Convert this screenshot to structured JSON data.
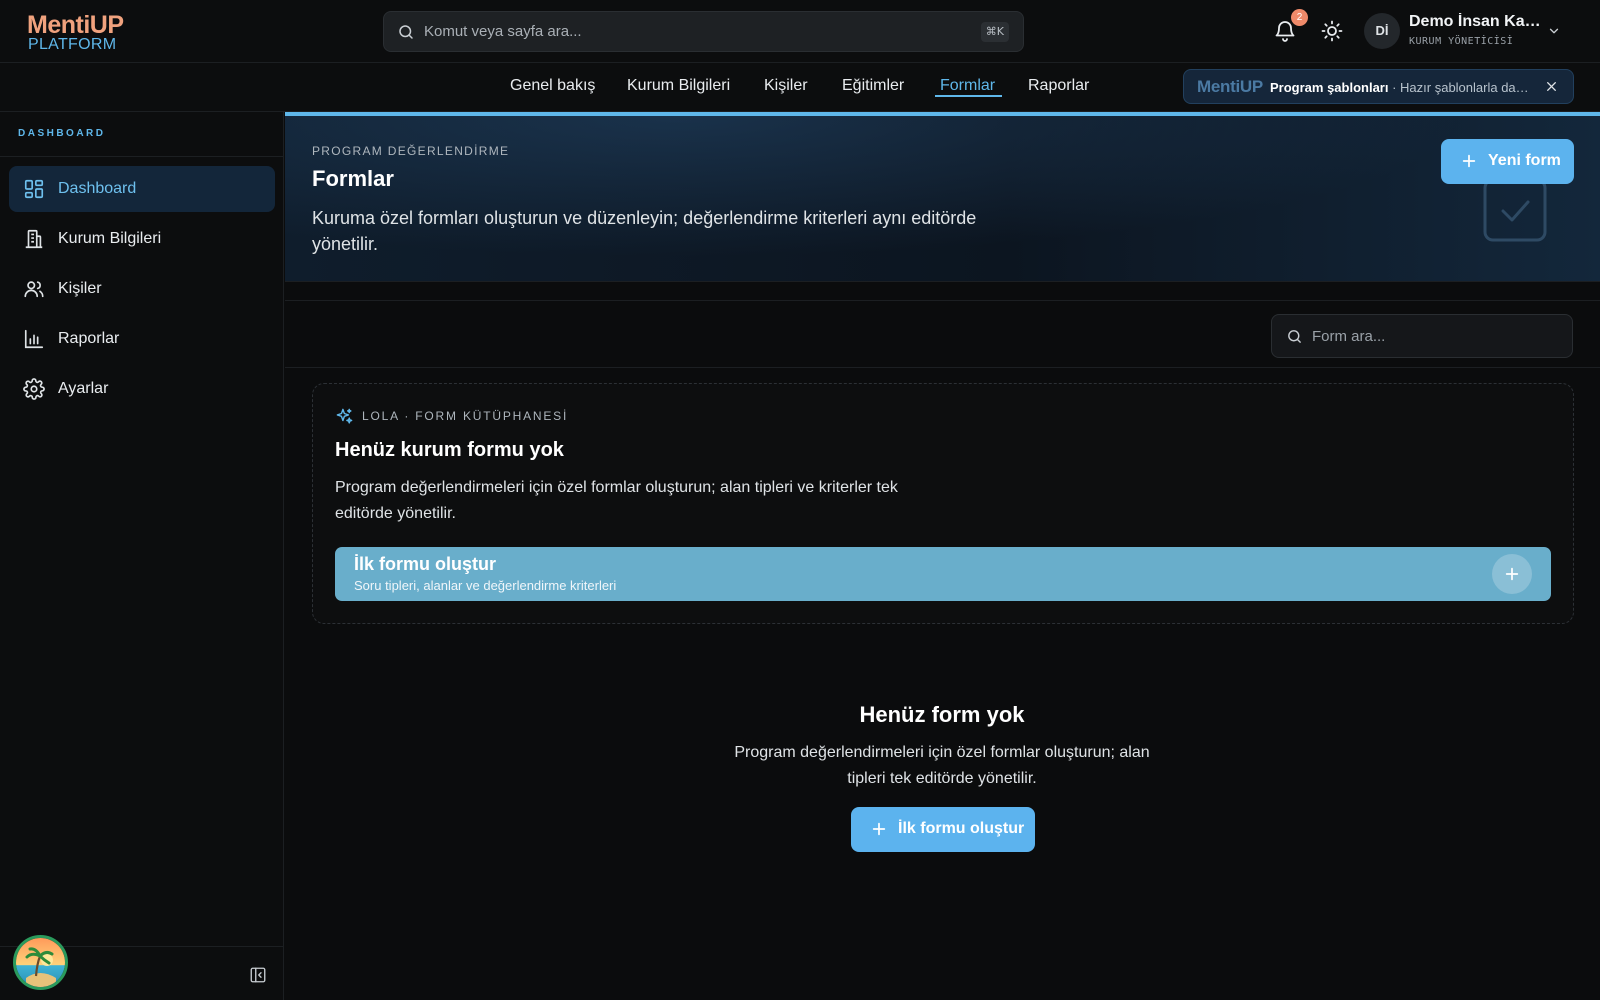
{
  "brand": {
    "line1": "MentiUP",
    "line2": "PLATFORM"
  },
  "command_search": {
    "placeholder": "Komut veya sayfa ara...",
    "shortcut": "⌘K"
  },
  "notifications": {
    "count": "2"
  },
  "user": {
    "initials": "Dİ",
    "name": "Demo İnsan Kaynakları",
    "role": "KURUM YÖNETİCİSİ"
  },
  "tabs": [
    {
      "label": "Genel bakış"
    },
    {
      "label": "Kurum Bilgileri"
    },
    {
      "label": "Kişiler"
    },
    {
      "label": "Eğitimler"
    },
    {
      "label": "Formlar",
      "active": true
    },
    {
      "label": "Raporlar"
    }
  ],
  "promo": {
    "logo": "MentiUP",
    "bold": "Program şablonları",
    "text": " · Hazır şablonlarla dakikalar içinde program oluşturun"
  },
  "sidebar": {
    "section": "DASHBOARD",
    "items": [
      {
        "label": "Dashboard",
        "icon": "dashboard-icon",
        "active": true
      },
      {
        "label": "Kurum Bilgileri",
        "icon": "building-icon"
      },
      {
        "label": "Kişiler",
        "icon": "users-icon"
      },
      {
        "label": "Raporlar",
        "icon": "bar-chart-icon"
      },
      {
        "label": "Ayarlar",
        "icon": "gear-icon"
      }
    ]
  },
  "hero": {
    "eyebrow": "PROGRAM DEĞERLENDİRME",
    "title": "Formlar",
    "description": "Kuruma özel formları oluşturun ve düzenleyin; değerlendirme kriterleri aynı editörde yönetilir.",
    "new_button": "Yeni form"
  },
  "form_search": {
    "placeholder": "Form ara..."
  },
  "library": {
    "eyebrow": "LOLA · FORM KÜTÜPHANESİ",
    "title": "Henüz kurum formu yok",
    "description": "Program değerlendirmeleri için özel formlar oluşturun; alan tipleri ve kriterler tek editörde yönetilir.",
    "create_title": "İlk formu oluştur",
    "create_subtitle": "Soru tipleri, alanlar ve değerlendirme kriterleri"
  },
  "empty_state": {
    "title": "Henüz form yok",
    "description": "Program değerlendirmeleri için özel formlar oluşturun; alan tipleri tek editörde yönetilir.",
    "button": "İlk formu oluştur"
  },
  "colors": {
    "accent": "#5fb7ea",
    "brand_orange": "#f0a27e",
    "primary_button": "#5cb3ee",
    "create_card": "#69aecb",
    "badge": "#ef8a6a"
  }
}
